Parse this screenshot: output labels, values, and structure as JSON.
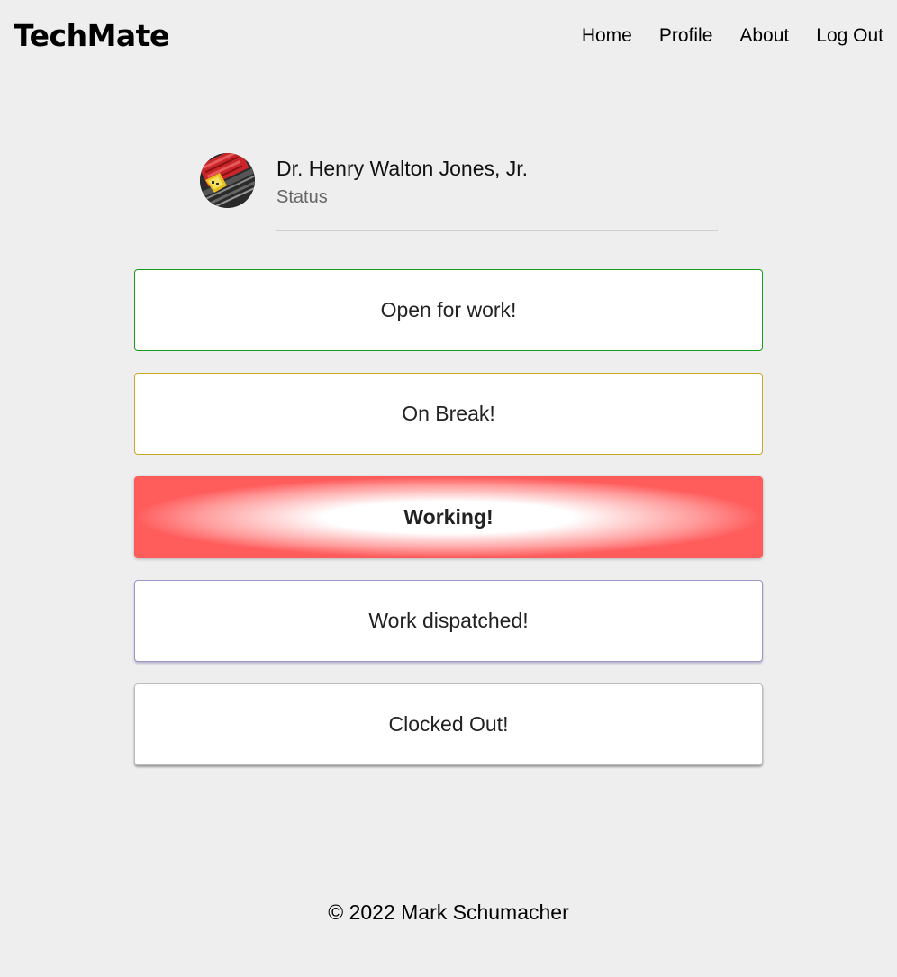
{
  "navbar": {
    "brand": "TechMate",
    "links": [
      "Home",
      "Profile",
      "About",
      "Log Out"
    ]
  },
  "profile": {
    "name": "Dr. Henry Walton Jones, Jr.",
    "status_label": "Status",
    "avatar_icon": "circuit-board-avatar"
  },
  "statuses": [
    {
      "label": "Open for work!",
      "color": "#1a9c1a",
      "active": false
    },
    {
      "label": "On Break!",
      "color": "#c8a820",
      "active": false
    },
    {
      "label": "Working!",
      "color": "#ff5a5a",
      "active": true
    },
    {
      "label": "Work dispatched!",
      "color": "#9b95c8",
      "active": false
    },
    {
      "label": "Clocked Out!",
      "color": "#bcbcbc",
      "active": false
    }
  ],
  "footer": {
    "copyright": "© 2022 Mark Schumacher"
  }
}
